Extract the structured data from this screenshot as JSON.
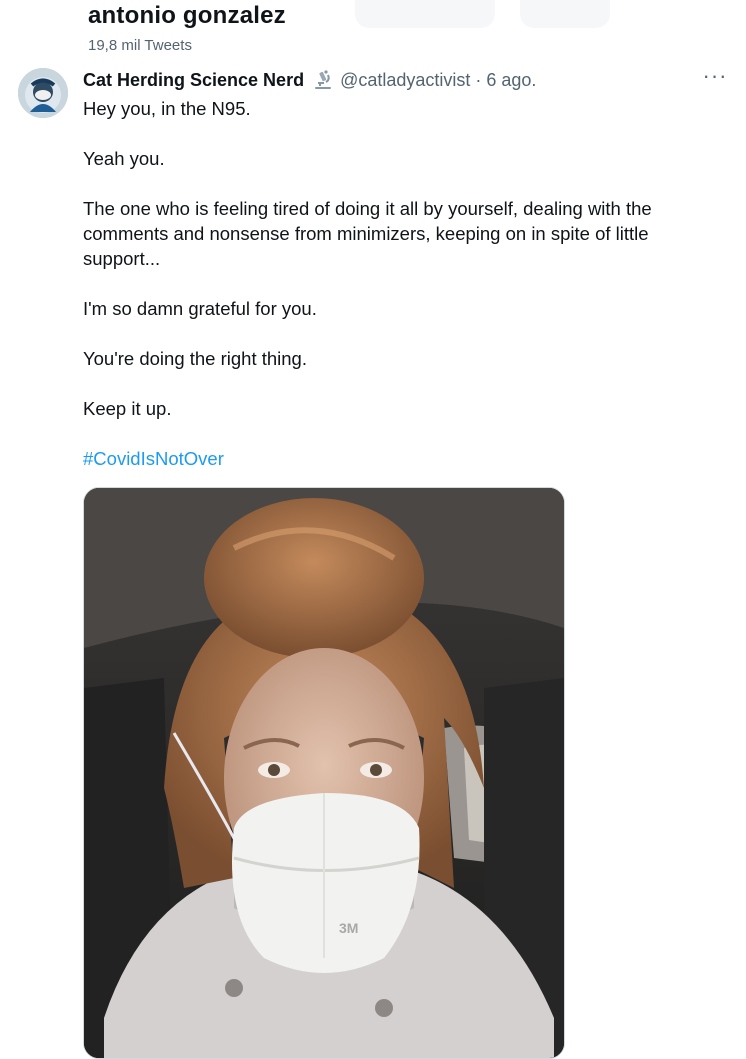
{
  "profile_header": {
    "name": "antonio gonzalez",
    "tweet_count": "19,8 mil Tweets"
  },
  "tweet": {
    "author_name": "Cat Herding Science Nerd",
    "badge_icon": "microscope-icon",
    "handle": "@catladyactivist",
    "separator": "·",
    "time": "6 ago.",
    "more_label": "···",
    "lines": [
      "Hey you, in the N95.",
      "Yeah you.",
      "The one who is feeling tired of doing it all by yourself, dealing with the comments and nonsense from minimizers, keeping on in spite of little support...",
      "I'm so damn grateful for you.",
      "You're doing the right thing.",
      "Keep it up."
    ],
    "hashtag": "#CovidIsNotOver",
    "mask_brand": "3M"
  },
  "colors": {
    "text": "#0f1419",
    "secondary": "#536471",
    "link": "#1d9bf0"
  }
}
